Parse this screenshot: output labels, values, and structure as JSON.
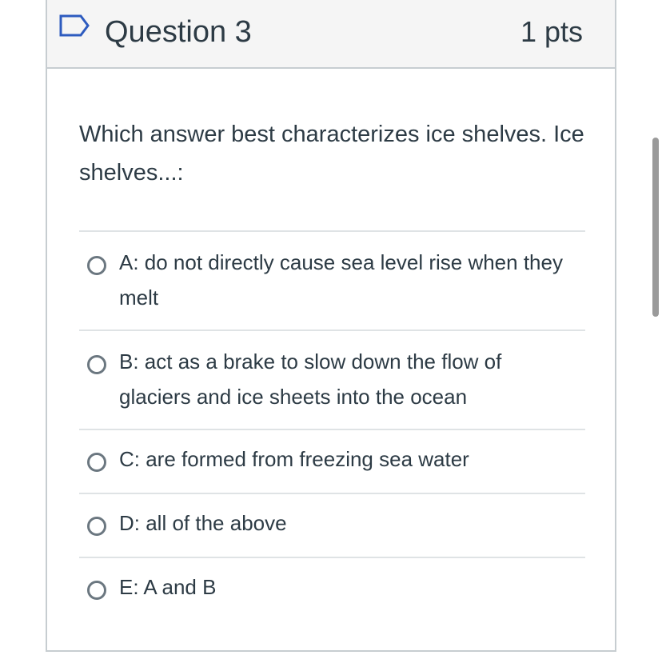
{
  "question": {
    "title": "Question 3",
    "points": "1 pts",
    "text": "Which answer best characterizes ice shelves. Ice shelves...:"
  },
  "answers": [
    {
      "label": "A: do not directly cause sea level rise when they melt"
    },
    {
      "label": "B: act as a brake to slow down the flow of glaciers and ice sheets into the ocean"
    },
    {
      "label": "C: are formed from freezing sea water"
    },
    {
      "label": "D: all of the above"
    },
    {
      "label": "E: A and B"
    }
  ],
  "colors": {
    "text": "#2d3b45",
    "header_bg": "#f5f5f5",
    "border": "#c7cdd1",
    "flag": "#2d5bbf",
    "radio": "#6b7780"
  }
}
